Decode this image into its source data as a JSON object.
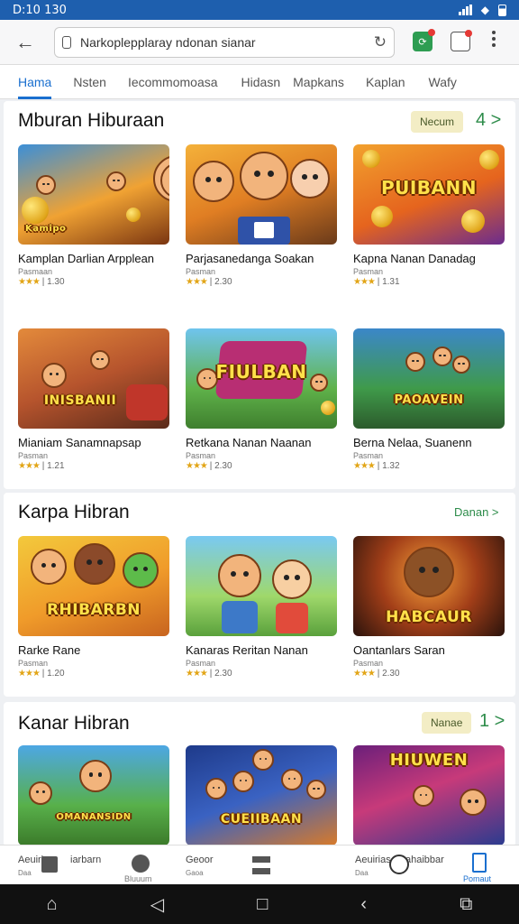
{
  "status": {
    "time": "D:10 130"
  },
  "browser": {
    "url": "Narkoplepplaray ndonan sianar"
  },
  "tabs": [
    "Hama",
    "Nsten",
    "Iecommomoasa",
    "Hidasn",
    "Mapkans",
    "Kaplan",
    "Wafy"
  ],
  "sections": [
    {
      "title": "Mburan Hiburaan",
      "pill": "Necum",
      "arrow": "4 >",
      "cards": [
        {
          "title": "Kamplan Darlian Arpplean",
          "sub": "Pasmaan",
          "stars": "★★★",
          "rating": "| 1.30",
          "art": "Kamipo"
        },
        {
          "title": "Parjasanedanga Soakan",
          "sub": "Pasman",
          "stars": "★★★",
          "rating": "| 2.30",
          "art": ""
        },
        {
          "title": "Kapna Nanan Danadag",
          "sub": "Pasman",
          "stars": "★★★",
          "rating": "| 1.31",
          "art": "PUIBANN"
        }
      ]
    },
    {
      "title": "",
      "cards": [
        {
          "title": "Mianiam Sanamnapsap",
          "sub": "Pasman",
          "stars": "★★★",
          "rating": "| 1.21",
          "art": "INISBANII"
        },
        {
          "title": "Retkana Nanan Naanan",
          "sub": "Pasman",
          "stars": "★★★",
          "rating": "| 2.30",
          "art": "FIULBAN"
        },
        {
          "title": "Berna Nelaa, Suanenn",
          "sub": "Pasman",
          "stars": "★★★",
          "rating": "| 1.32",
          "art": "PAOAVEIN"
        }
      ]
    },
    {
      "title": "Karpa Hibran",
      "link": "Danan >",
      "cards": [
        {
          "title": "Rarke Rane",
          "sub": "Pasman",
          "stars": "★★★",
          "rating": "| 1.20",
          "art": "RHIBARBN"
        },
        {
          "title": "Kanaras Reritan Nanan",
          "sub": "Pasman",
          "stars": "★★★",
          "rating": "| 2.30",
          "art": ""
        },
        {
          "title": "Oantanlars Saran",
          "sub": "Pasman",
          "stars": "★★★",
          "rating": "| 2.30",
          "art": "HABCAUR"
        }
      ]
    },
    {
      "title": "Kanar Hibran",
      "pill": "Nanae",
      "arrow": "1 >",
      "cards": [
        {
          "art": "OMANANSIDN"
        },
        {
          "art": "CUEIIBAAN"
        },
        {
          "art": "HIUWEN"
        }
      ]
    }
  ],
  "bottom_nav": [
    {
      "l1": "Aeuirl",
      "l2": "Daa",
      "l1b": "iarbarn",
      "l2b": "Daa"
    },
    {
      "l1": "Bluuum"
    },
    {
      "l1": "Geoor",
      "l2": "Gaoa"
    },
    {
      "l1": ""
    },
    {
      "l1": "Aeuirias",
      "l2": "Daa",
      "l1b": "ahaibbar"
    },
    {
      "l1": "Pomaut"
    }
  ]
}
